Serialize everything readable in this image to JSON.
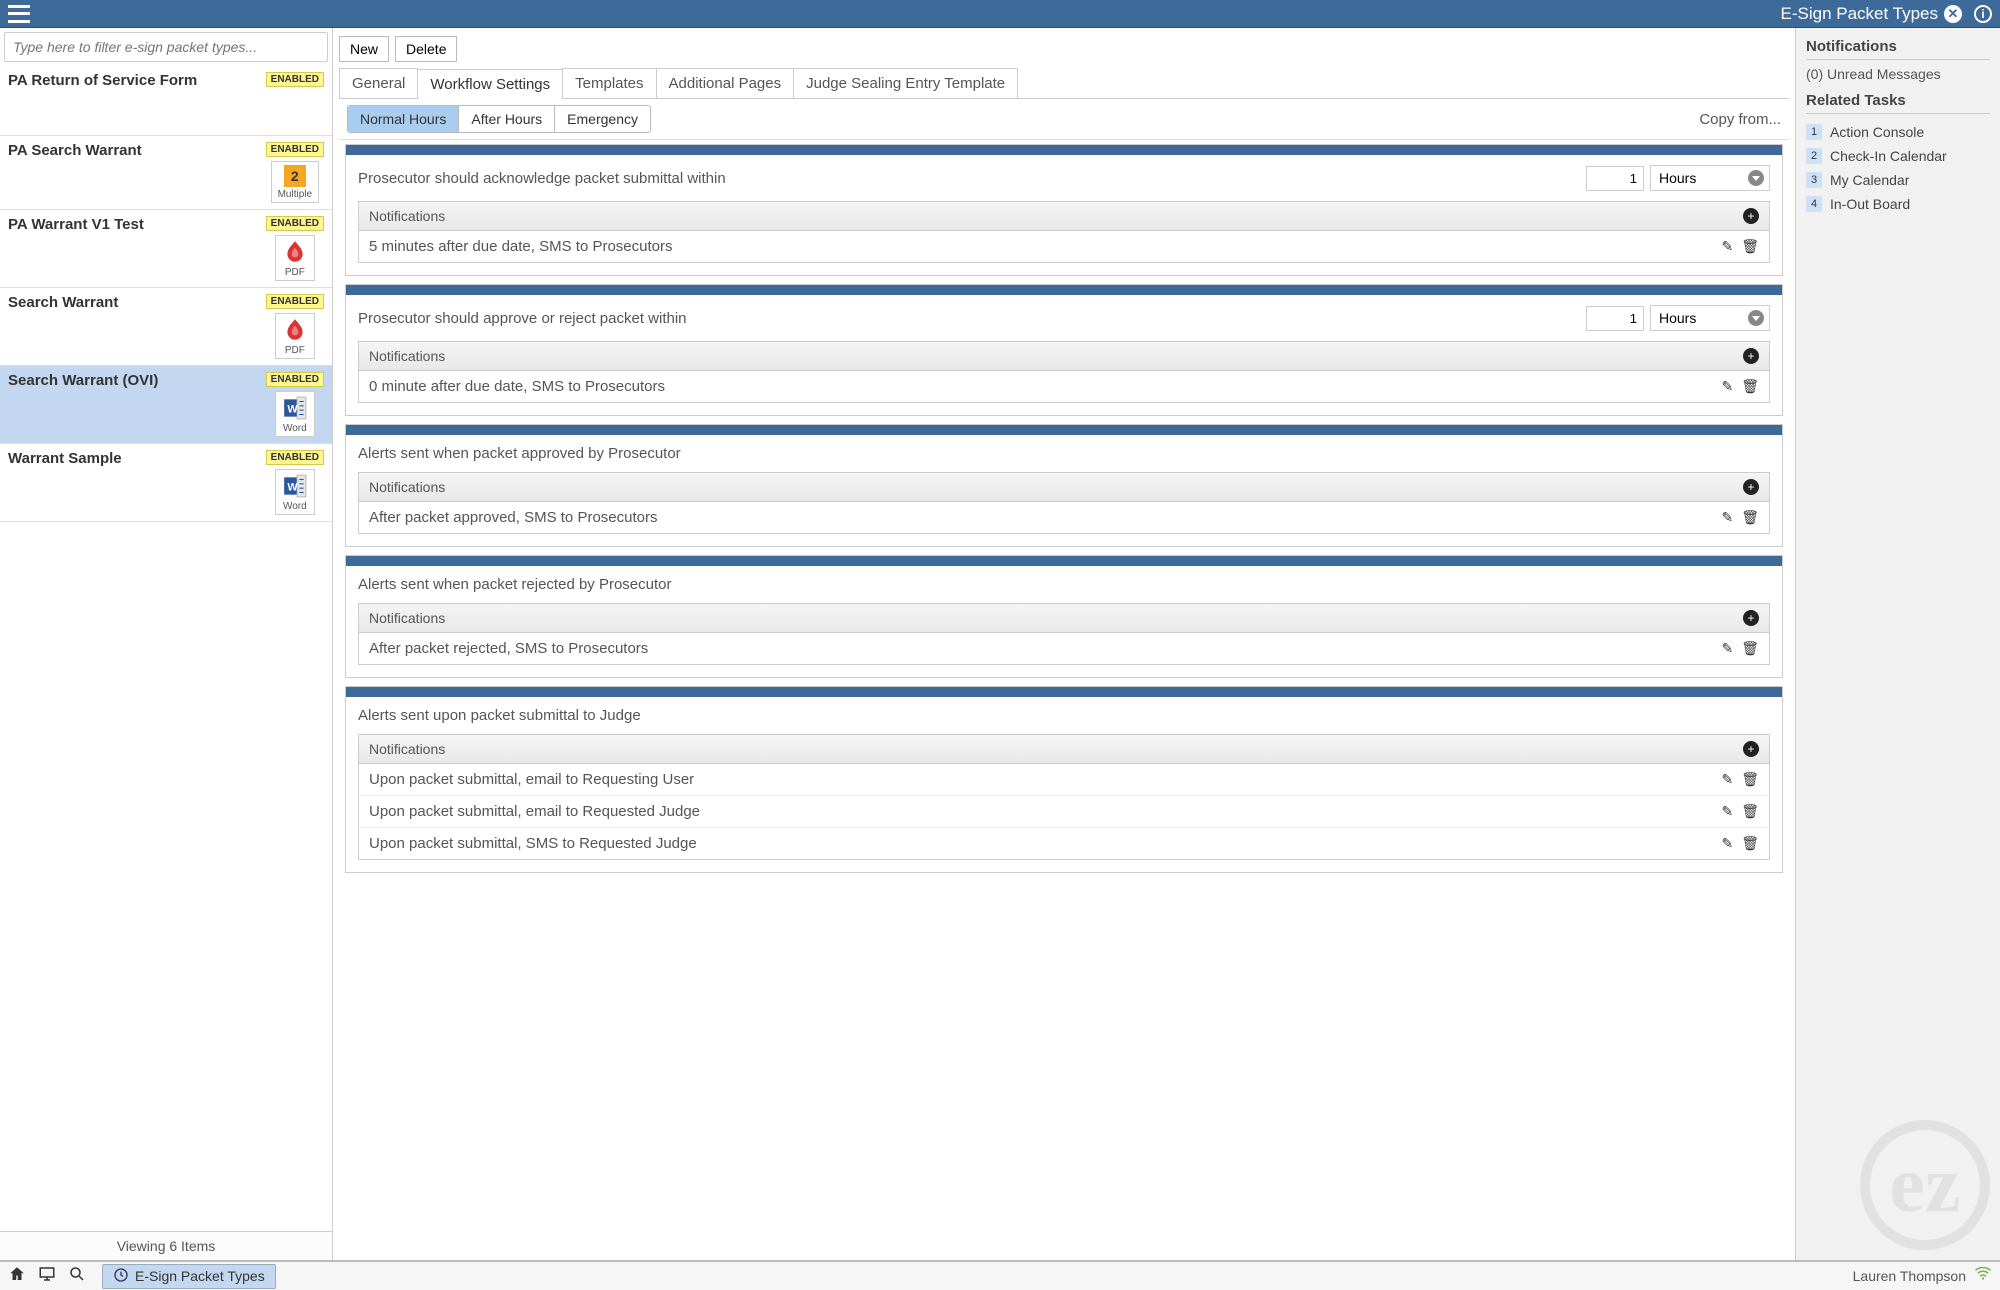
{
  "topbar": {
    "title": "E-Sign Packet Types"
  },
  "left": {
    "filter_placeholder": "Type here to filter e-sign packet types...",
    "items": [
      {
        "name": "PA Return of Service Form",
        "enabled": "ENABLED",
        "icon": null
      },
      {
        "name": "PA Search Warrant",
        "enabled": "ENABLED",
        "icon": "multi",
        "caption": "Multiple",
        "count": "2"
      },
      {
        "name": "PA Warrant V1 Test",
        "enabled": "ENABLED",
        "icon": "pdf",
        "caption": "PDF"
      },
      {
        "name": "Search Warrant",
        "enabled": "ENABLED",
        "icon": "pdf",
        "caption": "PDF"
      },
      {
        "name": "Search Warrant (OVI)",
        "enabled": "ENABLED",
        "icon": "word",
        "caption": "Word",
        "selected": true
      },
      {
        "name": "Warrant Sample",
        "enabled": "ENABLED",
        "icon": "word",
        "caption": "Word"
      }
    ],
    "footer": "Viewing 6 Items"
  },
  "center": {
    "toolbar": {
      "new": "New",
      "delete": "Delete"
    },
    "tabs": [
      "General",
      "Workflow Settings",
      "Templates",
      "Additional Pages",
      "Judge Sealing Entry Template"
    ],
    "active_tab": 1,
    "sub_tabs": [
      "Normal Hours",
      "After Hours",
      "Emergency"
    ],
    "active_sub_tab": 0,
    "copy_from": "Copy from...",
    "sections": [
      {
        "label": "Prosecutor should acknowledge packet submittal within",
        "value": "1",
        "unit": "Hours",
        "notif_title": "Notifications",
        "rows": [
          "5 minutes after due date, SMS to Prosecutors"
        ]
      },
      {
        "label": "Prosecutor should approve or reject packet within",
        "value": "1",
        "unit": "Hours",
        "notif_title": "Notifications",
        "rows": [
          "0 minute after due date, SMS to Prosecutors"
        ]
      },
      {
        "label": "Alerts sent when packet approved by Prosecutor",
        "notif_title": "Notifications",
        "rows": [
          "After packet approved, SMS to Prosecutors"
        ]
      },
      {
        "label": "Alerts sent when packet rejected by Prosecutor",
        "notif_title": "Notifications",
        "rows": [
          "After packet rejected, SMS to Prosecutors"
        ]
      },
      {
        "label": "Alerts sent upon packet submittal to Judge",
        "notif_title": "Notifications",
        "rows": [
          "Upon packet submittal, email to Requesting User",
          "Upon packet submittal, email to Requested Judge",
          "Upon packet submittal, SMS to Requested Judge"
        ]
      }
    ]
  },
  "right": {
    "notif_heading": "Notifications",
    "unread": "(0) Unread Messages",
    "tasks_heading": "Related Tasks",
    "tasks": [
      "Action Console",
      "Check-In Calendar",
      "My Calendar",
      "In-Out Board"
    ]
  },
  "bottom": {
    "open_tab": "E-Sign Packet Types",
    "user": "Lauren Thompson"
  }
}
